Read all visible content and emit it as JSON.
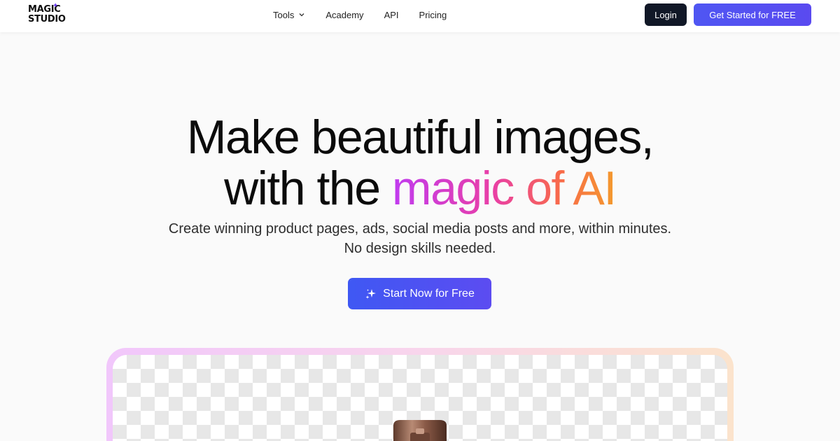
{
  "header": {
    "logo_line1": "MAGIC",
    "logo_line2": "STUDIO",
    "nav": [
      {
        "label": "Tools",
        "has_dropdown": true
      },
      {
        "label": "Academy"
      },
      {
        "label": "API"
      },
      {
        "label": "Pricing"
      }
    ],
    "login_label": "Login",
    "get_started_label": "Get Started for FREE"
  },
  "hero": {
    "line1": "Make beautiful images,",
    "line2_prefix": "with the ",
    "line2_highlight": "magic of AI",
    "subtitle_line1": "Create winning product pages, ads, social media posts and more, within minutes.",
    "subtitle_line2": "No design skills needed.",
    "cta_label": "Start Now for Free",
    "cta_icon": "sparkle-icon"
  },
  "colors": {
    "primary": "#4f56f2",
    "login_bg": "#111827",
    "gradient_text": [
      "#c03bf0",
      "#e93fa6",
      "#f86a4a",
      "#f49a2d"
    ],
    "frame_gradient": [
      "#f1c7fb",
      "#fbe3cc"
    ]
  }
}
